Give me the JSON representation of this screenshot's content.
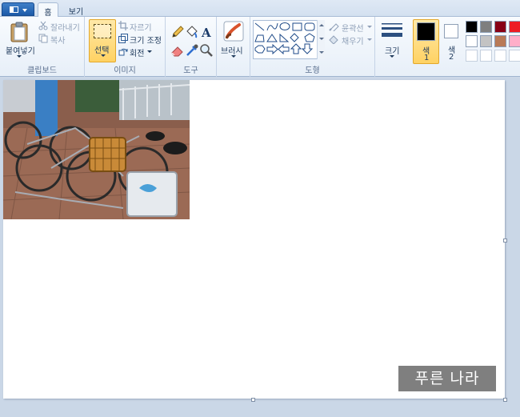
{
  "tabs": {
    "home": "홈",
    "view": "보기"
  },
  "clipboard": {
    "paste": "붙여넣기",
    "cut": "잘라내기",
    "copy": "복사",
    "label": "클립보드"
  },
  "image": {
    "select": "선택",
    "crop": "자르기",
    "resize": "크기 조정",
    "rotate": "회전",
    "label": "이미지"
  },
  "tools": {
    "label": "도구"
  },
  "brushes": {
    "label": "브러시"
  },
  "shapes": {
    "outline": "윤곽선",
    "fill": "채우기",
    "label": "도형"
  },
  "size": {
    "label": "크기"
  },
  "colors": {
    "color1_label": "색",
    "color1_num": "1",
    "color2_label": "색",
    "color2_num": "2",
    "color1_value": "#000000",
    "color2_value": "#ffffff",
    "palette": [
      "#000000",
      "#7f7f7f",
      "#880015",
      "#ed1c24",
      "#ffffff",
      "#c3c3c3",
      "#b97a57",
      "#ffaec9",
      "#ffffff",
      "#ffffff",
      "#ffffff",
      "#ffffff"
    ]
  },
  "canvas": {
    "watermark": "푸른 나라"
  },
  "icons": {
    "app_menu": "paint-menu-icon",
    "paste": "clipboard-icon",
    "cut": "scissors-icon",
    "copy": "copy-icon",
    "select": "selection-rectangle-icon",
    "crop": "crop-icon",
    "resize": "resize-icon",
    "rotate": "rotate-icon",
    "pencil": "pencil-icon",
    "fill": "paint-bucket-icon",
    "text": "text-icon",
    "eraser": "eraser-icon",
    "picker": "color-picker-icon",
    "magnifier": "magnifier-icon",
    "brush": "brush-icon",
    "outline": "outline-icon",
    "fill_shape": "fill-icon",
    "size": "line-size-icon"
  }
}
